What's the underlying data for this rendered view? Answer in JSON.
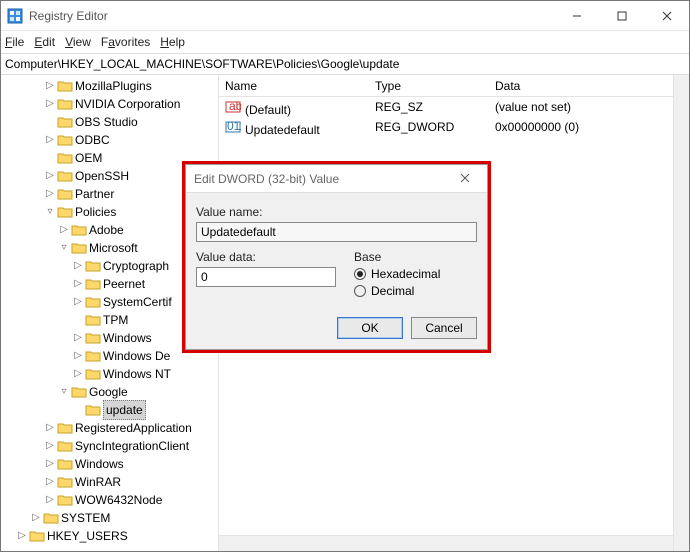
{
  "window": {
    "title": "Registry Editor"
  },
  "menu": {
    "file": "File",
    "edit": "Edit",
    "view": "View",
    "favorites": "Favorites",
    "help": "Help"
  },
  "address": {
    "path": "Computer\\HKEY_LOCAL_MACHINE\\SOFTWARE\\Policies\\Google\\update"
  },
  "tree": {
    "nodes": [
      {
        "d": 3,
        "t": ">",
        "label": "MozillaPlugins"
      },
      {
        "d": 3,
        "t": ">",
        "label": "NVIDIA Corporation"
      },
      {
        "d": 3,
        "t": "",
        "label": "OBS Studio"
      },
      {
        "d": 3,
        "t": ">",
        "label": "ODBC"
      },
      {
        "d": 3,
        "t": "",
        "label": "OEM"
      },
      {
        "d": 3,
        "t": ">",
        "label": "OpenSSH"
      },
      {
        "d": 3,
        "t": ">",
        "label": "Partner"
      },
      {
        "d": 3,
        "t": "v",
        "label": "Policies"
      },
      {
        "d": 4,
        "t": ">",
        "label": "Adobe"
      },
      {
        "d": 4,
        "t": "v",
        "label": "Microsoft"
      },
      {
        "d": 5,
        "t": ">",
        "label": "Cryptograph"
      },
      {
        "d": 5,
        "t": ">",
        "label": "Peernet"
      },
      {
        "d": 5,
        "t": ">",
        "label": "SystemCertif"
      },
      {
        "d": 5,
        "t": "",
        "label": "TPM"
      },
      {
        "d": 5,
        "t": ">",
        "label": "Windows"
      },
      {
        "d": 5,
        "t": ">",
        "label": "Windows De"
      },
      {
        "d": 5,
        "t": ">",
        "label": "Windows NT"
      },
      {
        "d": 4,
        "t": "v",
        "label": "Google"
      },
      {
        "d": 5,
        "t": "",
        "label": "update",
        "selected": true
      },
      {
        "d": 3,
        "t": ">",
        "label": "RegisteredApplication"
      },
      {
        "d": 3,
        "t": ">",
        "label": "SyncIntegrationClient"
      },
      {
        "d": 3,
        "t": ">",
        "label": "Windows"
      },
      {
        "d": 3,
        "t": ">",
        "label": "WinRAR"
      },
      {
        "d": 3,
        "t": ">",
        "label": "WOW6432Node"
      },
      {
        "d": 2,
        "t": ">",
        "label": "SYSTEM"
      },
      {
        "d": 1,
        "t": ">",
        "label": "HKEY_USERS"
      }
    ]
  },
  "list": {
    "columns": {
      "name": "Name",
      "type": "Type",
      "data": "Data"
    },
    "rows": [
      {
        "icon": "str",
        "name": "(Default)",
        "type": "REG_SZ",
        "data": "(value not set)"
      },
      {
        "icon": "bin",
        "name": "Updatedefault",
        "type": "REG_DWORD",
        "data": "0x00000000 (0)"
      }
    ]
  },
  "dialog": {
    "title": "Edit DWORD (32-bit) Value",
    "value_name_label": "Value name:",
    "value_name": "Updatedefault",
    "value_data_label": "Value data:",
    "value_data": "0",
    "base_label": "Base",
    "hex_label": "Hexadecimal",
    "dec_label": "Decimal",
    "base_selected": "hex",
    "ok": "OK",
    "cancel": "Cancel"
  }
}
